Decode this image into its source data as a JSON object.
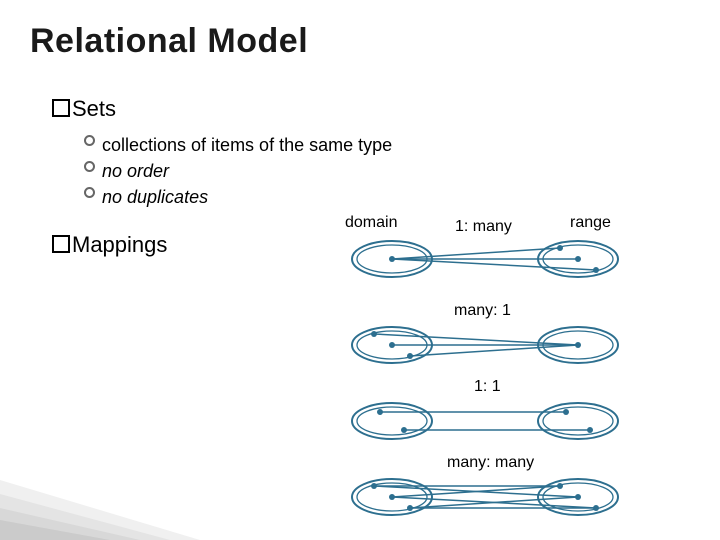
{
  "title": "Relational Model",
  "bullets": {
    "sets": "Sets",
    "mappings": "Mappings",
    "sets_items": [
      "collections of items of the same type",
      "no order",
      "no duplicates"
    ]
  },
  "labels": {
    "domain": "domain",
    "range": "range",
    "one_many": "1: many",
    "many_one": "many: 1",
    "one_one": "1: 1",
    "many_many": "many: many"
  }
}
